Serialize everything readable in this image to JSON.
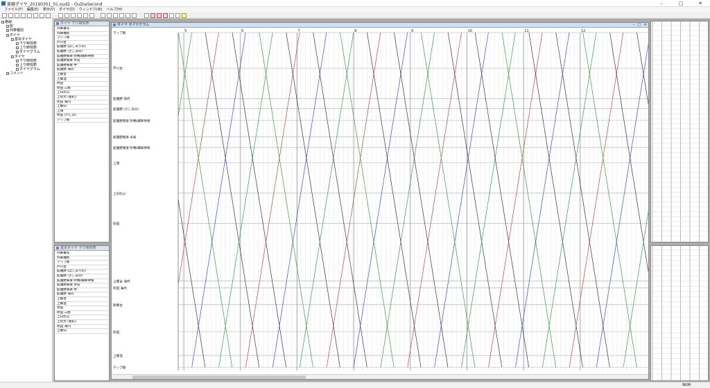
{
  "window": {
    "title": "某線ダイヤ_20190301_01.oud2 - OuDiaSecond"
  },
  "menu": [
    "ファイル(F)",
    "編集(E)",
    "表示(V)",
    "ダイヤ(D)",
    "ウィンドウ(W)",
    "ヘルプ(H)"
  ],
  "tree": [
    {
      "label": "路線",
      "indent": 0
    },
    {
      "label": "駅",
      "indent": 1
    },
    {
      "label": "列車種別",
      "indent": 1
    },
    {
      "label": "ダイヤ",
      "indent": 1
    },
    {
      "label": "基本ダイヤ",
      "indent": 2
    },
    {
      "label": "下り時刻表",
      "indent": 3
    },
    {
      "label": "上り時刻表",
      "indent": 3
    },
    {
      "label": "ダイヤグラム",
      "indent": 3
    },
    {
      "label": "ダイヤ",
      "indent": 2
    },
    {
      "label": "下り時刻表",
      "indent": 3
    },
    {
      "label": "上り時刻表",
      "indent": 3
    },
    {
      "label": "ダイヤグラム",
      "indent": 3
    },
    {
      "label": "コメント",
      "indent": 1
    }
  ],
  "windows": {
    "upper_timetable": "ダイヤ 下り時刻表",
    "lower_timetable": "基本ダイヤ 下り時刻表",
    "diagram": "ダイヤ ダイヤグラム"
  },
  "timetable_rows": [
    "列車番号",
    "列車種別",
    "マップ駅",
    "芦川台",
    "館雅野 (ばしありの)",
    "館雅野 (さしあの)",
    "館雅野東楽 吹鴨/練師神保",
    "館雅野東楽 手前",
    "館雅野東楽 中",
    "館雅野 海内",
    "上郷台",
    "上郷温",
    "吹田",
    "吹田 三鷹",
    "上日比公",
    "上府大 (長町)",
    "吹田 海内",
    "上郷山",
    "上嶺",
    "吹田 (六しあ)",
    "マップ駅"
  ],
  "diagram_stations": [
    {
      "name": "マップ駅",
      "pos": 0.0
    },
    {
      "name": "芦川台",
      "pos": 0.105
    },
    {
      "name": "館雅野 海内",
      "pos": 0.195
    },
    {
      "name": "館雅野 (さしあの)",
      "pos": 0.225
    },
    {
      "name": "館雅野東楽 吹鴨/練師神保",
      "pos": 0.26
    },
    {
      "name": "館雅野東楽 手前",
      "pos": 0.308
    },
    {
      "name": "館雅野東楽 吹鴨/練師神保",
      "pos": 0.34
    },
    {
      "name": "上嶺",
      "pos": 0.385
    },
    {
      "name": "上日比公",
      "pos": 0.475
    },
    {
      "name": "吹田",
      "pos": 0.565
    },
    {
      "name": "上郷台 海内",
      "pos": 0.735
    },
    {
      "name": "吹田 海内",
      "pos": 0.755
    },
    {
      "name": "新郷台",
      "pos": 0.805
    },
    {
      "name": "吹田",
      "pos": 0.885
    },
    {
      "name": "上郷温",
      "pos": 0.955
    },
    {
      "name": "マップ駅",
      "pos": 0.99
    }
  ],
  "hour_labels": [
    "5",
    "6",
    "7",
    "8",
    "9",
    "10",
    "11",
    "12"
  ],
  "colors": {
    "titlebar": "#ffffff",
    "mdi": "#ababab",
    "line_black": "#333333",
    "line_green": "#3a9a4a",
    "line_red": "#b84a3a",
    "line_blue": "#3050d0"
  },
  "status": {
    "right": "NUM"
  }
}
